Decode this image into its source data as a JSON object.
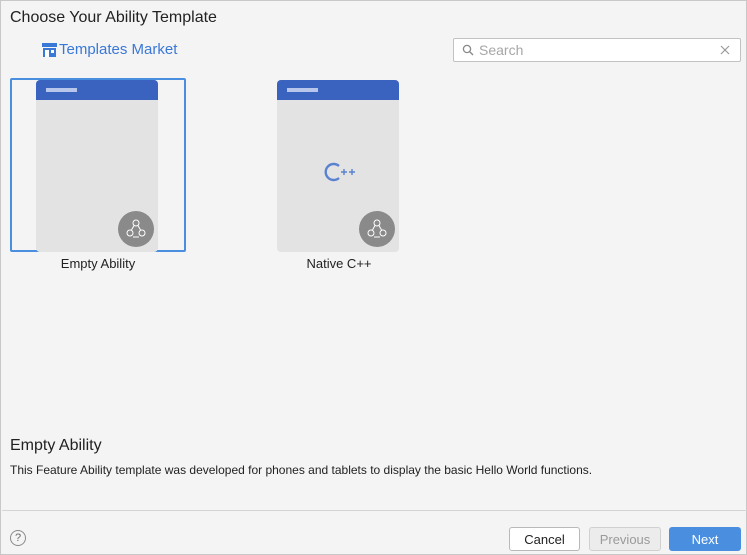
{
  "dialog": {
    "title": "Choose Your Ability Template"
  },
  "market": {
    "label": "Templates Market",
    "icon": "store-icon",
    "color": "#3a78d8"
  },
  "search": {
    "placeholder": "Search",
    "value": "",
    "icon": "search-icon",
    "clear_icon": "clear-icon"
  },
  "templates": [
    {
      "label": "Empty Ability",
      "selected": true,
      "badge_icon": "harmony-share-icon"
    },
    {
      "label": "Native C++",
      "selected": false,
      "center_icon": "cpp-icon",
      "badge_icon": "harmony-share-icon"
    }
  ],
  "description": {
    "title": "Empty Ability",
    "text": "This Feature Ability template was developed for phones and tablets to display the basic Hello World functions."
  },
  "footer": {
    "help_label": "?",
    "cancel_label": "Cancel",
    "previous_label": "Previous",
    "next_label": "Next"
  },
  "colors": {
    "accent": "#4a8ee0",
    "card_header": "#3a63c0",
    "card_body": "#e3e3e3",
    "badge": "#8a8a8a"
  }
}
